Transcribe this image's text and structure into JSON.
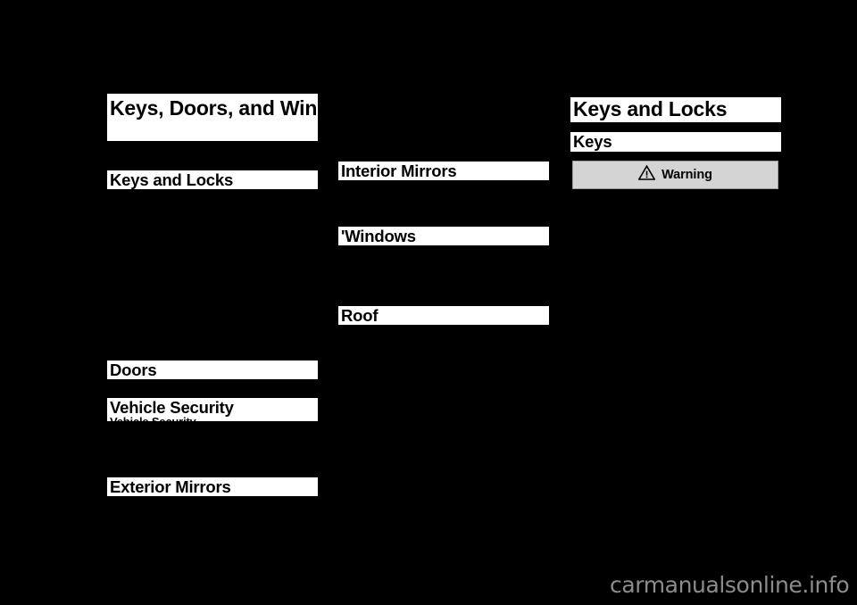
{
  "page": {
    "background_color": "#000000",
    "band_color": "#ffffff",
    "text_color": "#000000",
    "warning_bg_color": "#d4d4d4",
    "watermark_color": "#8c8c8c"
  },
  "chapter_title": "Keys, Doors, and Windows",
  "columns": {
    "left": {
      "sections": [
        {
          "label": "Keys and Locks",
          "level": "h1"
        },
        {
          "label": "Doors",
          "level": "h1"
        },
        {
          "label": "Vehicle Security",
          "level": "h1",
          "clipped_entry": "Vehicle Security"
        },
        {
          "label": "Exterior Mirrors",
          "level": "h1"
        }
      ]
    },
    "middle": {
      "sections": [
        {
          "label": "Interior Mirrors",
          "level": "h1"
        },
        {
          "label": "Windows",
          "level": "h1",
          "leading_mark": "'"
        },
        {
          "label": "Roof",
          "level": "h1"
        }
      ]
    },
    "right": {
      "heading": "Keys and Locks",
      "subheading": "Keys",
      "warning": {
        "label": "Warning",
        "icon": "warning-triangle-icon"
      }
    }
  },
  "watermark": "carmanualsonline.info"
}
